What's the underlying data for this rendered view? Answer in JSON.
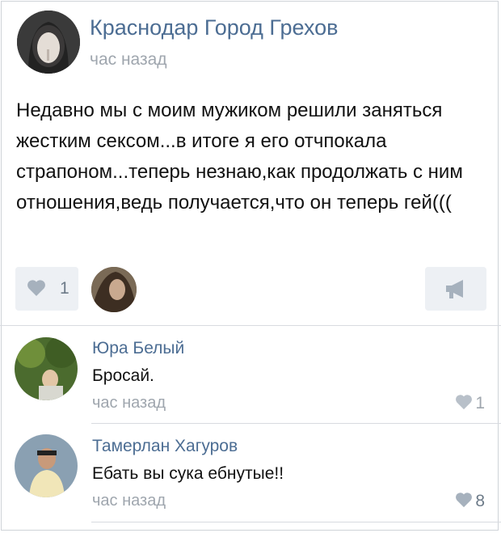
{
  "post": {
    "author": "Краснодар Город Грехов",
    "time": "час назад",
    "text": "Недавно мы с моим мужиком решили заняться жестким сексом...в итоге я его отчпокала страпоном...теперь незнаю,как продолжать с ним отношения,ведь получается,что он теперь гей(((",
    "likes": "1"
  },
  "comments": [
    {
      "author": "Юра Белый",
      "text": "Бросай.",
      "time": "час назад",
      "likes": "1"
    },
    {
      "author": "Тамерлан Хагуров",
      "text": "Ебать вы сука ебнутые!!",
      "time": "час назад",
      "likes": "8"
    }
  ],
  "icons": {
    "like": "heart-icon",
    "share": "megaphone-icon"
  },
  "colors": {
    "link": "#4c6d93",
    "muted": "#9fa6ae",
    "button_bg": "#edf0f4"
  }
}
